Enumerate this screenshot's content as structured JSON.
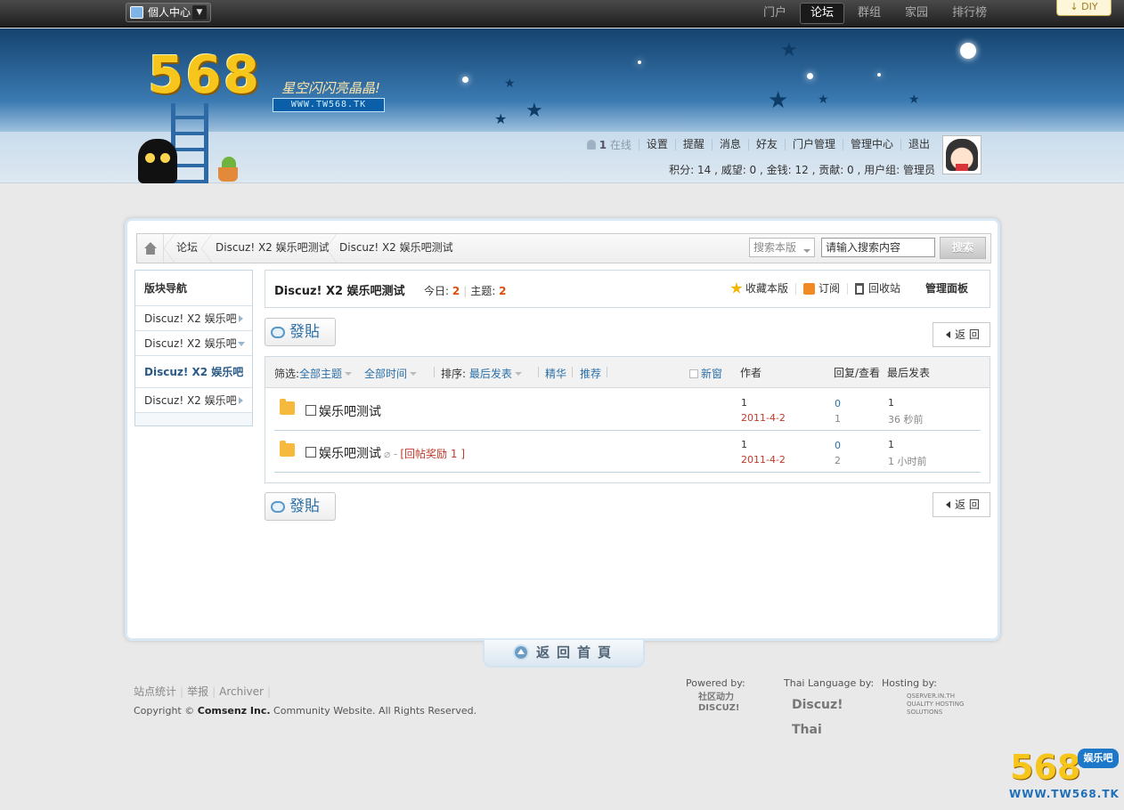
{
  "topbar": {
    "my_center": "個人中心",
    "nav": [
      "门户",
      "论坛",
      "群组",
      "家园",
      "排行榜"
    ],
    "active_nav": "论坛",
    "diy": "DIY"
  },
  "header": {
    "logo_text": "568",
    "slogan": "星空闪闪亮晶晶!",
    "url": "WWW.TW568.TK"
  },
  "userbar": {
    "online_count": "1",
    "online_label": "在线",
    "menu": [
      "设置",
      "提醒",
      "消息",
      "好友",
      "门户管理",
      "管理中心",
      "退出"
    ],
    "credits": "积分: 14 , 威望: 0 , 金钱: 12 , 贡献: 0 , 用户组: 管理员"
  },
  "breadcrumb": {
    "items": [
      "论坛",
      "Discuz! X2 娱乐吧测试",
      "Discuz! X2 娱乐吧测试"
    ]
  },
  "search": {
    "scope": "搜索本版",
    "value": "请输入搜索内容",
    "button": "搜索"
  },
  "sidenav": {
    "title": "版块导航",
    "items": [
      "Discuz! X2 娱乐吧",
      "Discuz! X2 娱乐吧",
      "Discuz! X2 娱乐吧",
      "Discuz! X2 娱乐吧"
    ]
  },
  "forum": {
    "title": "Discuz! X2 娱乐吧测试",
    "today_label": "今日:",
    "today": "2",
    "topics_label": "主题:",
    "topics": "2",
    "actions": [
      "收藏本版",
      "订阅",
      "回收站",
      "管理面板"
    ]
  },
  "buttons": {
    "post": "發貼",
    "back": "返 回",
    "back_home": "返回首頁"
  },
  "filter": {
    "label": "筛选:",
    "all_topics": "全部主题",
    "all_time": "全部时间",
    "sort_label": "排序:",
    "sort_value": "最后发表",
    "digest": "精华",
    "recommend": "推荐",
    "new_window": "新窗",
    "col_author": "作者",
    "col_replies": "回复/查看",
    "col_last": "最后发表"
  },
  "threads": [
    {
      "title": "娱乐吧测试",
      "extra": "",
      "author": "1",
      "date": "2011-4-2",
      "replies": "0",
      "views": "1",
      "last_poster": "1",
      "last_time": "36 秒前"
    },
    {
      "title": "娱乐吧测试",
      "extra": "[回帖奖励 1 ]",
      "author": "1",
      "date": "2011-4-2",
      "replies": "0",
      "views": "2",
      "last_poster": "1",
      "last_time": "1 小时前"
    }
  ],
  "footer": {
    "links": [
      "站点统计",
      "举报",
      "Archiver"
    ],
    "copyright_prefix": "Copyright ©",
    "company": "Comsenz Inc.",
    "copyright_suffix": "Community Website. All Rights Reserved.",
    "powered_by": "Powered by:",
    "thai_by": "Thai Language by:",
    "hosting_by": "Hosting by:",
    "powered_logo": "社区动力 DISCUZ!",
    "thai_logo": "Discuz! Thai",
    "hosting_logo": "QSERVER.IN.TH QUALITY HOSTING SOLUTIONS"
  },
  "corner": {
    "logo": "568",
    "badge": "娱乐吧",
    "url": "WWW.TW568.TK"
  }
}
